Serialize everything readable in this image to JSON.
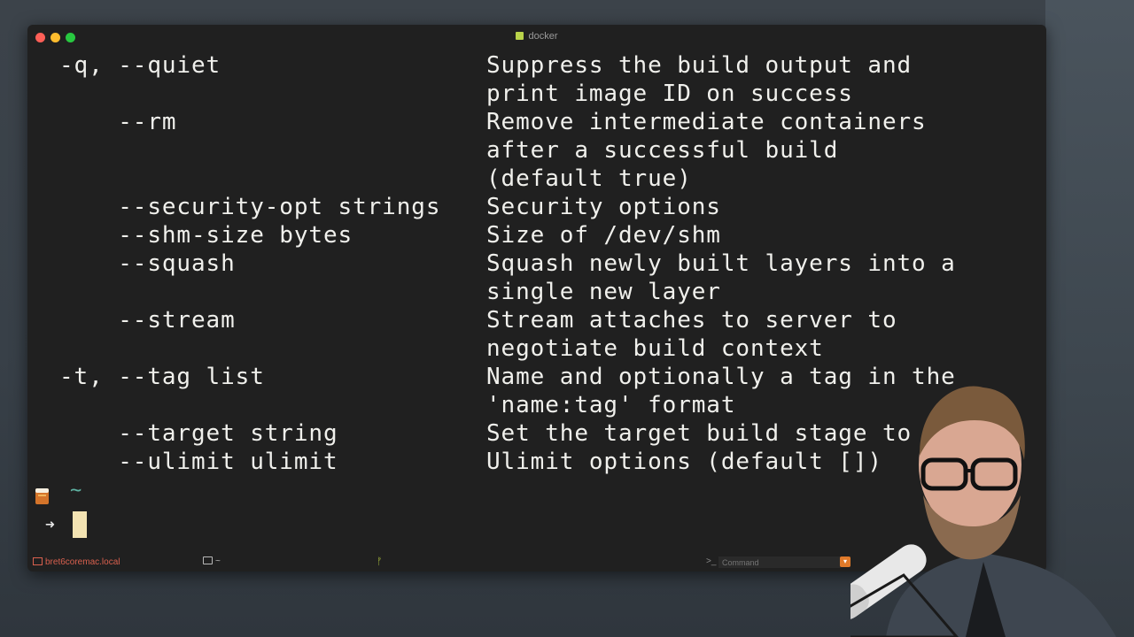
{
  "window": {
    "title": "docker",
    "title_icon": "terminal-icon"
  },
  "terminal": {
    "lines": [
      {
        "opt": "-q, --quiet",
        "desc": "Suppress the build output and"
      },
      {
        "opt": "",
        "desc": "print image ID on success"
      },
      {
        "opt": "    --rm",
        "desc": "Remove intermediate containers"
      },
      {
        "opt": "",
        "desc": "after a successful build"
      },
      {
        "opt": "",
        "desc": "(default true)"
      },
      {
        "opt": "    --security-opt strings",
        "desc": "Security options"
      },
      {
        "opt": "    --shm-size bytes",
        "desc": "Size of /dev/shm"
      },
      {
        "opt": "    --squash",
        "desc": "Squash newly built layers into a"
      },
      {
        "opt": "",
        "desc": "single new layer"
      },
      {
        "opt": "    --stream",
        "desc": "Stream attaches to server to"
      },
      {
        "opt": "",
        "desc": "negotiate build context"
      },
      {
        "opt": "-t, --tag list",
        "desc": "Name and optionally a tag in the"
      },
      {
        "opt": "",
        "desc": "'name:tag' format"
      },
      {
        "opt": "    --target string",
        "desc": "Set the target build stage to"
      },
      {
        "opt": "    --ulimit ulimit",
        "desc": "Ulimit options (default [])"
      }
    ],
    "prompt": {
      "dir": "~",
      "arrow": "➜"
    }
  },
  "statusbar": {
    "host": "bret6coremac.local",
    "dir": "~",
    "branch_icon": "ᚠ",
    "command_prompt": ">_",
    "command_placeholder": "Command"
  },
  "colors": {
    "terminal_bg": "#202020",
    "terminal_fg": "#f0f0ec",
    "host_color": "#d9604e",
    "tilde_color": "#5fb3a3",
    "cursor_color": "#f3e3b2"
  }
}
